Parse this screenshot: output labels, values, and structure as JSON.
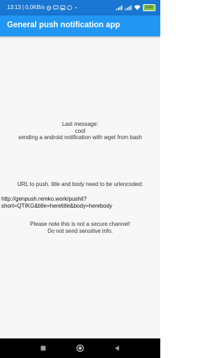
{
  "status_bar": {
    "time": "13:13",
    "separator": "|",
    "net_speed": "0,0KB/s",
    "battery": "100"
  },
  "app_bar": {
    "title": "General push notification app"
  },
  "main": {
    "last_message_label": "Last message:",
    "last_message_title": "cool",
    "last_message_body": "sending a android notification with wget from bash",
    "url_instruction": "URL to push. title and body need to be urlencoded:",
    "url_line1": "http://genpush.remko.work/pushit?",
    "url_line2": "short=QTIKG&title=heretitle&body=herebody",
    "warning_line1": "Please note this is not a secure channel!",
    "warning_line2": "Do not send sensitive info."
  },
  "nav_bar": {
    "icons": [
      "recents-icon",
      "home-icon",
      "back-icon"
    ]
  },
  "colors": {
    "status_bar": "#1976d2",
    "app_bar": "#2196f3",
    "background": "#f7f7f7",
    "nav_bar": "#000000"
  }
}
